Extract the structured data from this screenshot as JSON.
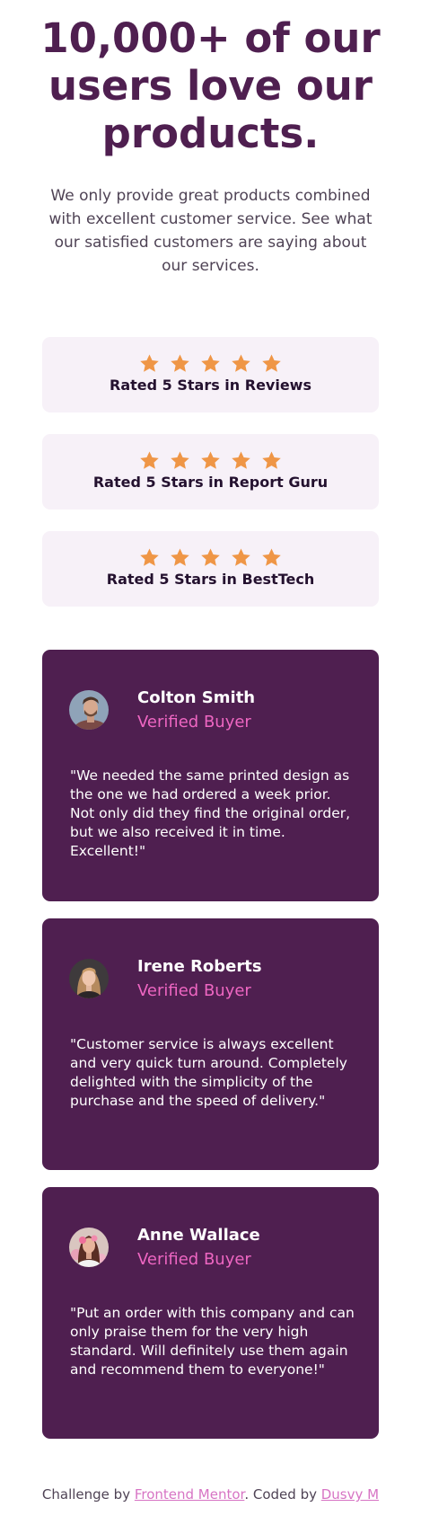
{
  "hero": {
    "title": "10,000+ of our users love our products.",
    "description": "We only provide great products combined with excellent customer service. See what our satisfied customers are saying about our services."
  },
  "ratings": [
    {
      "label": "Rated 5 Stars in Reviews",
      "stars": 5
    },
    {
      "label": "Rated 5 Stars in Report Guru",
      "stars": 5
    },
    {
      "label": "Rated 5 Stars in BestTech",
      "stars": 5
    }
  ],
  "testimonials": [
    {
      "name": "Colton Smith",
      "status": "Verified Buyer",
      "quote": "\"We needed the same printed design as the one we had ordered a week prior. Not only did they find the original order, but we also received it in time. Excellent!\""
    },
    {
      "name": "Irene Roberts",
      "status": "Verified Buyer",
      "quote": "\"Customer service is always excellent and very quick turn around. Completely delighted with the simplicity of the purchase and the speed of delivery.\""
    },
    {
      "name": "Anne Wallace",
      "status": "Verified Buyer",
      "quote": "\"Put an order with this company and can only praise them for the very high standard. Will definitely use them again and recommend them to everyone!\""
    }
  ],
  "footer": {
    "challenge_prefix": "Challenge by ",
    "challenge_link": "Frontend Mentor",
    "coded_prefix": ". Coded by ",
    "coded_link": "Dusvy M"
  },
  "colors": {
    "dark_magenta": "#4f1f50",
    "light_pink_bg": "#f7f1f8",
    "star_orange": "#ef9646",
    "soft_pink": "#ee66c2",
    "text_gray": "#4f4355"
  },
  "icons": {
    "rating_star": "star-icon"
  }
}
